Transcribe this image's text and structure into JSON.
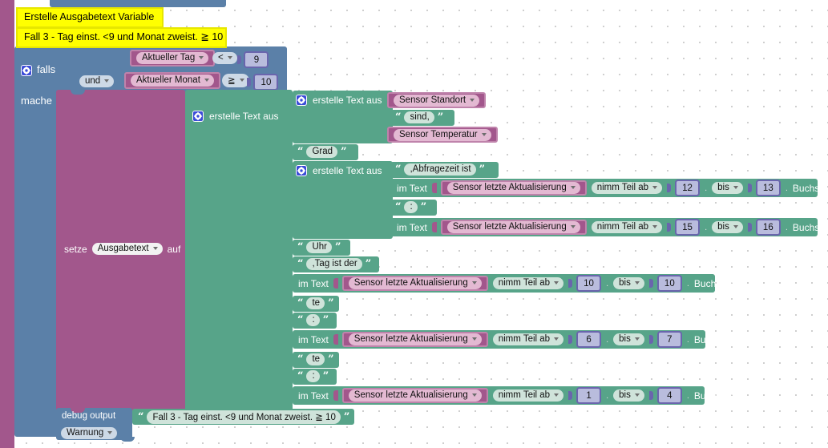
{
  "workspace": {
    "app": "Blockly visual programming workspace",
    "background": "#ffffff",
    "grid_dot_color": "#cfcfcf",
    "colors": {
      "control_blue": "#5b80a8",
      "variable_pink": "#a2578c",
      "text_green": "#57a489",
      "number_purple": "#6a65ad",
      "comment_yellow": "#ffff00"
    }
  },
  "comments": {
    "title": "Erstelle Ausgabetext Variable",
    "subtitle": "Fall 3 - Tag einst. <9 und Monat zweist. ≧ 10"
  },
  "if_block": {
    "if_label": "falls",
    "do_label": "mache",
    "gear_icon": "gear-icon",
    "conditions": [
      {
        "variable": "Aktueller Tag",
        "operator": "<",
        "value": "9"
      },
      {
        "join": "und",
        "variable": "Aktueller Monat",
        "operator": "≧",
        "value": "10"
      }
    ]
  },
  "set_block": {
    "set_label": "setze",
    "variable": "Ausgabetext",
    "to_label": "auf"
  },
  "create_text_outer": {
    "label": "erstelle Text aus",
    "gear_icon": "gear-icon"
  },
  "create_text_1": {
    "label": "erstelle Text aus",
    "gear_icon": "gear-icon",
    "items": [
      {
        "type": "variable",
        "value": "Sensor Standort"
      },
      {
        "type": "string",
        "value": " sind, "
      },
      {
        "type": "variable",
        "value": "Sensor Temperatur"
      }
    ]
  },
  "standalone_grad": {
    "type": "string",
    "value": "Grad"
  },
  "create_text_2": {
    "label": "erstelle Text aus",
    "gear_icon": "gear-icon",
    "items": [
      {
        "type": "string",
        "value": ",Abfragezeit ist"
      },
      {
        "type": "substring",
        "in_text_label": "im Text",
        "variable": "Sensor letzte Aktualisierung",
        "mode": "nimm Teil ab",
        "from": "12",
        "to_label": "bis",
        "to": "13",
        "unit_label": "Buchstabe"
      },
      {
        "type": "string",
        "value": ":"
      },
      {
        "type": "substring",
        "in_text_label": "im Text",
        "variable": "Sensor letzte Aktualisierung",
        "mode": "nimm Teil ab",
        "from": "15",
        "to_label": "bis",
        "to": "16",
        "unit_label": "Buchstabe"
      }
    ]
  },
  "outer_items_tail": [
    {
      "type": "string",
      "value": "Uhr"
    },
    {
      "type": "string",
      "value": ",Tag ist der"
    },
    {
      "type": "substring",
      "in_text_label": "im Text",
      "variable": "Sensor letzte Aktualisierung",
      "mode": "nimm Teil ab",
      "from": "10",
      "to_label": "bis",
      "to": "10",
      "unit_label": "Buchstabe"
    },
    {
      "type": "string",
      "value": "te"
    },
    {
      "type": "string",
      "value": ":"
    },
    {
      "type": "substring",
      "in_text_label": "im Text",
      "variable": "Sensor letzte Aktualisierung",
      "mode": "nimm Teil ab",
      "from": "6",
      "to_label": "bis",
      "to": "7",
      "unit_label": "Buchstabe"
    },
    {
      "type": "string",
      "value": "te"
    },
    {
      "type": "string",
      "value": ":"
    },
    {
      "type": "substring",
      "in_text_label": "im Text",
      "variable": "Sensor letzte Aktualisierung",
      "mode": "nimm Teil ab",
      "from": "1",
      "to_label": "bis",
      "to": "4",
      "unit_label": "Buchstabe"
    }
  ],
  "debug_block": {
    "label": "debug output",
    "message": "Fall 3 - Tag einst. <9 und Monat zweist. ≧ 10",
    "level": "Warnung"
  }
}
